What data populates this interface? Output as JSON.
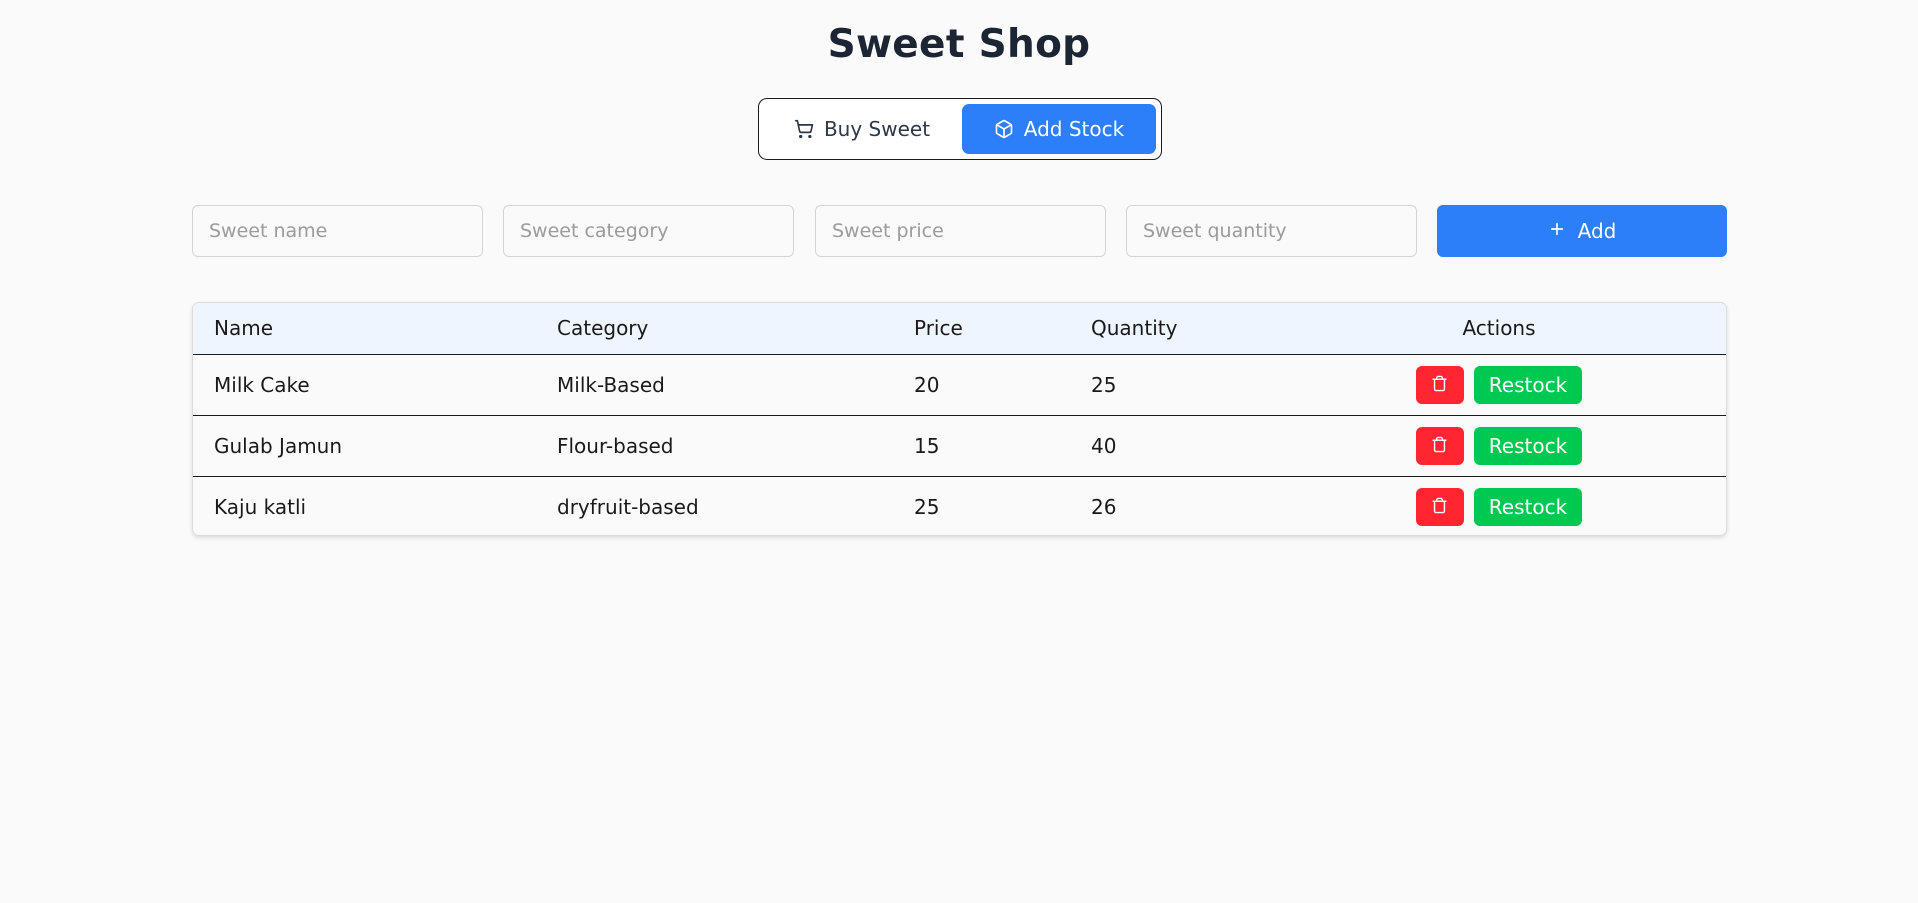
{
  "header": {
    "title": "Sweet Shop"
  },
  "mode_toggle": {
    "buy_label": "Buy Sweet",
    "buy_icon": "shopping-cart-icon",
    "stock_label": "Add Stock",
    "stock_icon": "package-icon",
    "active": "Add Stock"
  },
  "form": {
    "name_placeholder": "Sweet name",
    "category_placeholder": "Sweet category",
    "price_placeholder": "Sweet price",
    "quantity_placeholder": "Sweet quantity",
    "add_label": "Add",
    "add_icon": "plus-icon"
  },
  "table": {
    "columns": [
      "Name",
      "Category",
      "Price",
      "Quantity",
      "Actions"
    ],
    "rows": [
      {
        "name": "Milk Cake",
        "category": "Milk-Based",
        "price": "20",
        "quantity": "25"
      },
      {
        "name": "Gulab Jamun",
        "category": "Flour-based",
        "price": "15",
        "quantity": "40"
      },
      {
        "name": "Kaju katli",
        "category": "dryfruit-based",
        "price": "25",
        "quantity": "26"
      }
    ],
    "restock_label": "Restock",
    "delete_icon": "trash-icon"
  },
  "colors": {
    "primary": "#2d7ff9",
    "danger": "#ff2631",
    "success": "#00c951",
    "header_bg": "#eef5ff",
    "title": "#1c2534"
  }
}
